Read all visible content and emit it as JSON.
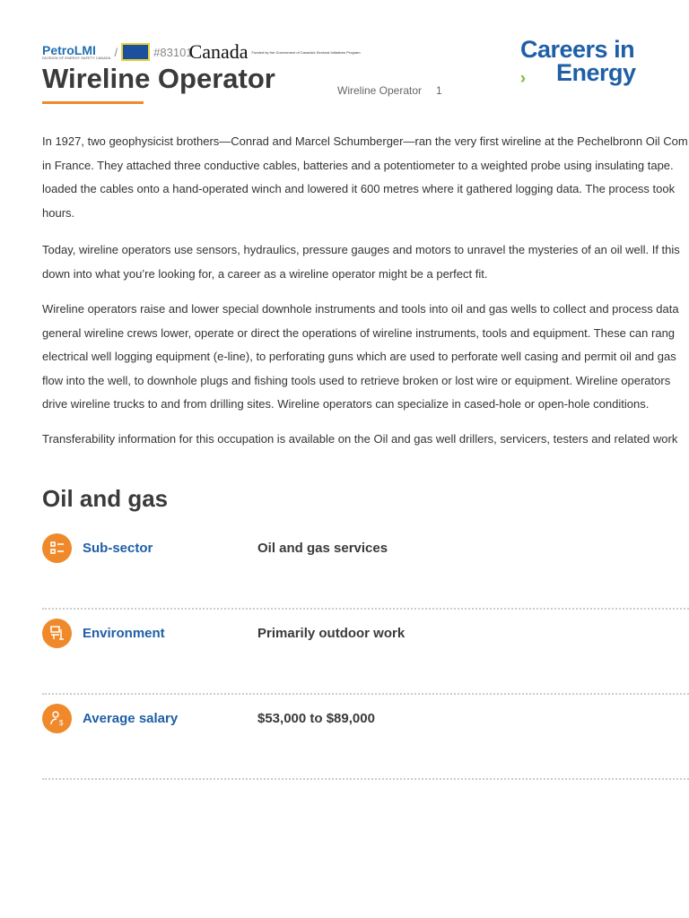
{
  "header": {
    "petrolmi": "PetroLMI",
    "petrolmi_sub": "DIVISION OF ENERGY SAFETY CANADA",
    "separator": "/",
    "code": "#83101",
    "canada": "Canada",
    "funded": "Funded by the Government of Canada's Sectoral Initiatives Program",
    "title": "Wireline Operator",
    "subtitle": "Wireline Operator",
    "page_number": "1",
    "logo_line1": "Careers in",
    "logo_line2": "Energy"
  },
  "paragraphs": [
    [
      "In 1927, two geophysicist brothers—Conrad and Marcel Schumberger—ran the very first wireline at the Pechelbronn Oil Com",
      "in France. They attached three conductive cables, batteries and a potentiometer to a weighted probe using insulating tape.",
      "loaded the cables onto a hand-operated winch and lowered it 600 metres where it gathered logging data. The process took",
      "hours."
    ],
    [
      "Today, wireline operators use sensors, hydraulics, pressure gauges and motors to unravel the mysteries of an oil well. If this",
      "down into what you’re looking for, a career as a wireline operator might be a perfect fit."
    ],
    [
      "Wireline operators raise and lower special downhole instruments and tools into oil and gas wells to collect and process data",
      "general wireline crews lower, operate or direct the operations of wireline instruments, tools and equipment. These can rang",
      "electrical well logging equipment (e-line), to perforating guns which are used to perforate well casing and permit oil and gas",
      "flow into the well, to downhole plugs and fishing tools used to retrieve broken or lost wire or equipment. Wireline operators",
      "drive wireline trucks to and from drilling sites. Wireline operators can specialize in cased-hole or open-hole conditions."
    ],
    [
      "Transferability information for this occupation is available on the Oil and gas well drillers, servicers, testers and related work"
    ]
  ],
  "section": {
    "title": "Oil and gas",
    "rows": [
      {
        "icon": "list-icon",
        "label": "Sub-sector",
        "value": "Oil and gas services"
      },
      {
        "icon": "environment-icon",
        "label": "Environment",
        "value": "Primarily outdoor work"
      },
      {
        "icon": "salary-icon",
        "label": "Average salary",
        "value": "$53,000 to $89,000"
      }
    ]
  },
  "colors": {
    "accent": "#f0892a",
    "link": "#1f5fa6",
    "text": "#333333"
  }
}
